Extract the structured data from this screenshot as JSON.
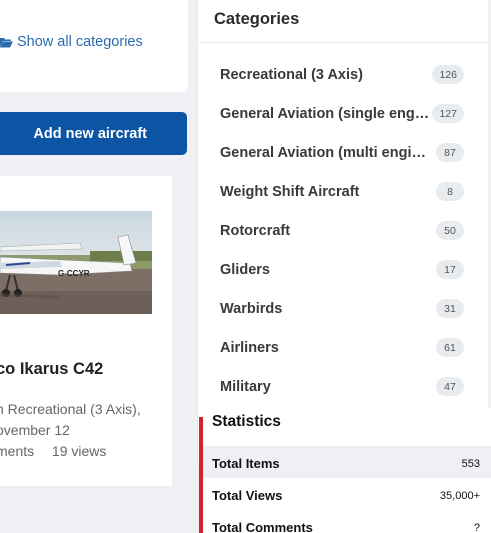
{
  "left": {
    "show_all_label": "Show all categories",
    "add_button_label": "Add new aircraft",
    "aircraft": {
      "title": "co Ikarus C42",
      "category_line": "n Recreational (3 Axis),",
      "date_line": "ovember 12",
      "comments_text": "ments",
      "views_text": "19 views"
    }
  },
  "categories": {
    "title": "Categories",
    "items": [
      {
        "label": "Recreational (3 Axis)",
        "count": "126"
      },
      {
        "label": "General Aviation (single engine)",
        "count": "127"
      },
      {
        "label": "General Aviation (multi engine)",
        "count": "87"
      },
      {
        "label": "Weight Shift Aircraft",
        "count": "8"
      },
      {
        "label": "Rotorcraft",
        "count": "50"
      },
      {
        "label": "Gliders",
        "count": "17"
      },
      {
        "label": "Warbirds",
        "count": "31"
      },
      {
        "label": "Airliners",
        "count": "61"
      },
      {
        "label": "Military",
        "count": "47"
      }
    ]
  },
  "statistics": {
    "title": "Statistics",
    "rows": [
      {
        "label": "Total Items",
        "value": "553"
      },
      {
        "label": "Total Views",
        "value": "35,000+"
      },
      {
        "label": "Total Comments",
        "value": "?"
      }
    ]
  },
  "colors": {
    "accent": "#0b55a4",
    "link": "#2b6cb0",
    "stats_bar": "#d6232f",
    "badge_bg": "#e9ecef"
  },
  "icons": {
    "show_all": "folder-open-icon"
  }
}
